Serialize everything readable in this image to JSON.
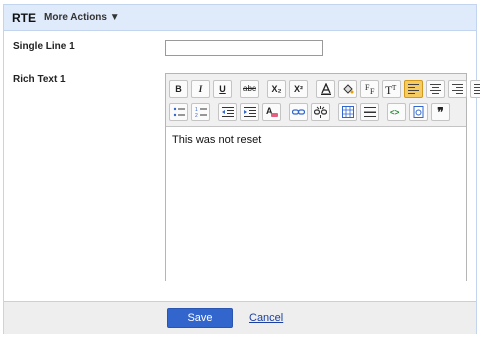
{
  "header": {
    "title": "RTE",
    "more_actions": "More Actions ▼"
  },
  "fields": {
    "single_label": "Single Line 1",
    "single_value": "",
    "rich_label": "Rich Text 1",
    "rich_content": "This was not reset"
  },
  "toolbar": {
    "bold": "B",
    "italic": "I",
    "underline": "U",
    "strike": "abc",
    "subscript": "X₂",
    "superscript": "X²",
    "text_size": "T",
    "quote": "❞"
  },
  "footer": {
    "save": "Save",
    "cancel": "Cancel"
  },
  "colors": {
    "header_bg": "#dfeafa",
    "save_bg": "#3366cc",
    "active_btn": "#f6cc62",
    "link": "#1b3fa0"
  }
}
